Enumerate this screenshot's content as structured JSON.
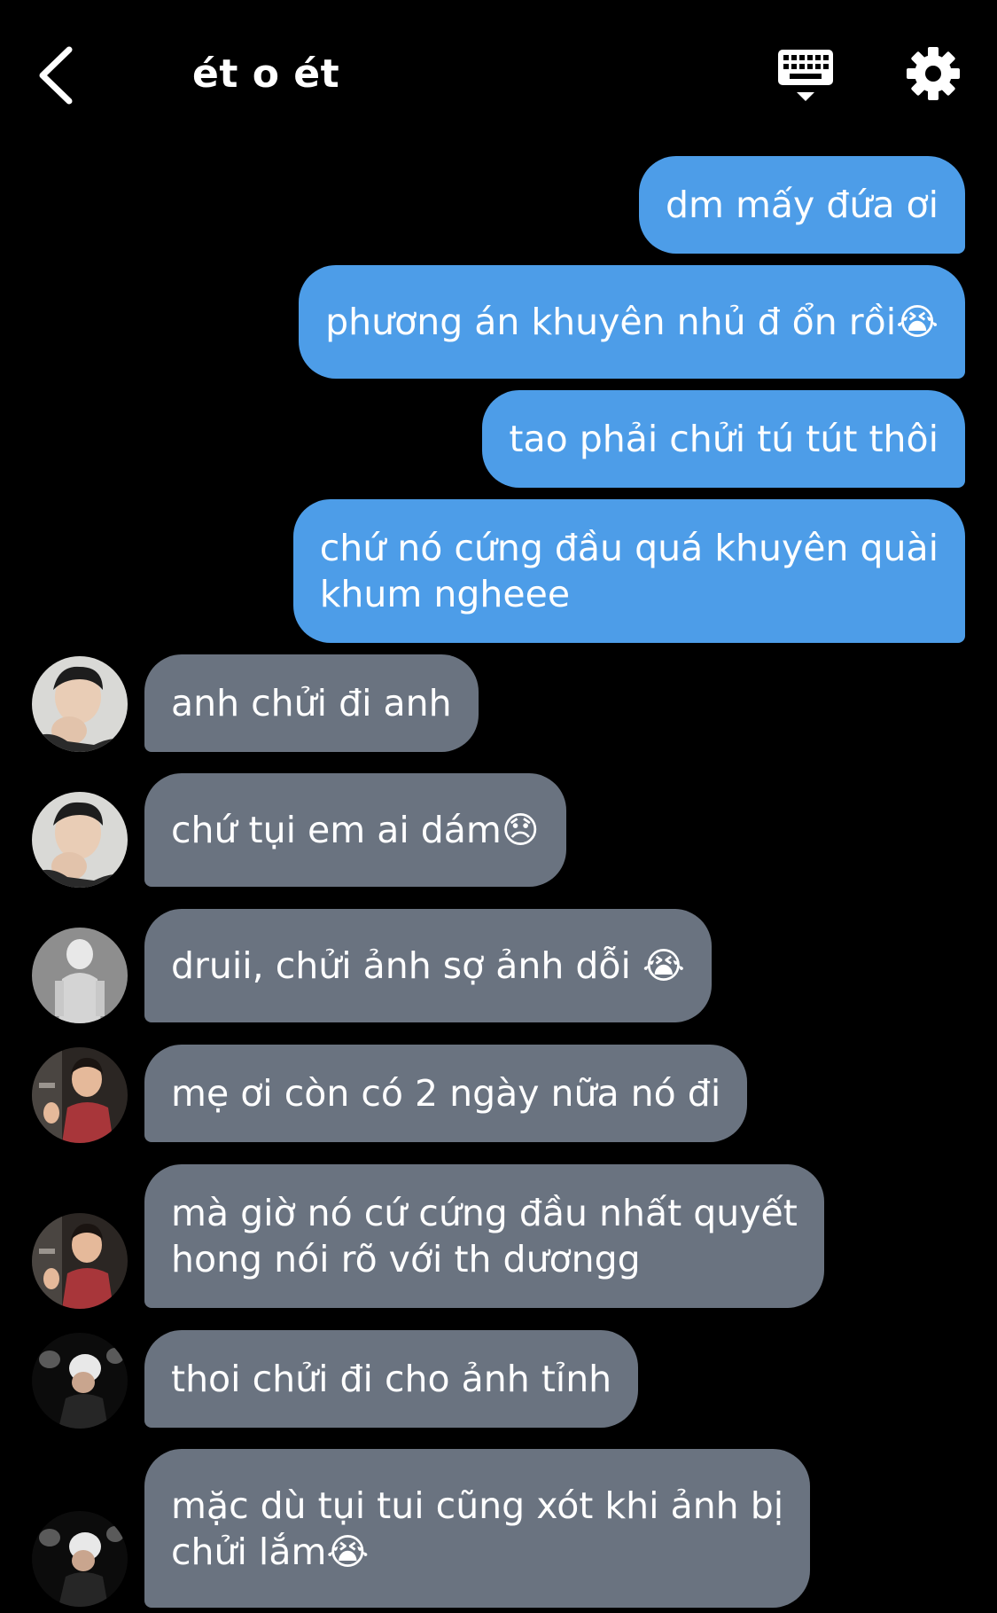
{
  "header": {
    "title": "ét o ét",
    "back_icon": "chevron-left-icon",
    "keyboard_icon": "keyboard-hide-icon",
    "settings_icon": "gear-icon"
  },
  "colors": {
    "background": "#000000",
    "outgoing_bubble": "#4d9de8",
    "incoming_bubble": "#6a7380",
    "text": "#ffffff"
  },
  "messages": {
    "out": [
      "dm mấy đứa ơi",
      "phương án khuyên nhủ đ ổn rồi😭",
      "tao phải chửi tú tút thôi",
      "chứ nó cứng đầu quá khuyên quài\nkhum ngheee"
    ],
    "in": [
      "anh chửi đi anh",
      "chứ tụi em ai dám😞",
      "druii, chửi ảnh sợ ảnh dỗi 😭",
      "mẹ ơi còn có 2 ngày nữa nó đi",
      "mà giờ nó cứ cứng đầu nhất quyết\nhong nói rõ với th dươngg",
      "thoi chửi đi cho ảnh tỉnh",
      "mặc dù tụi tui cũng xót khi ảnh bị\nchửi lắm😭"
    ]
  }
}
